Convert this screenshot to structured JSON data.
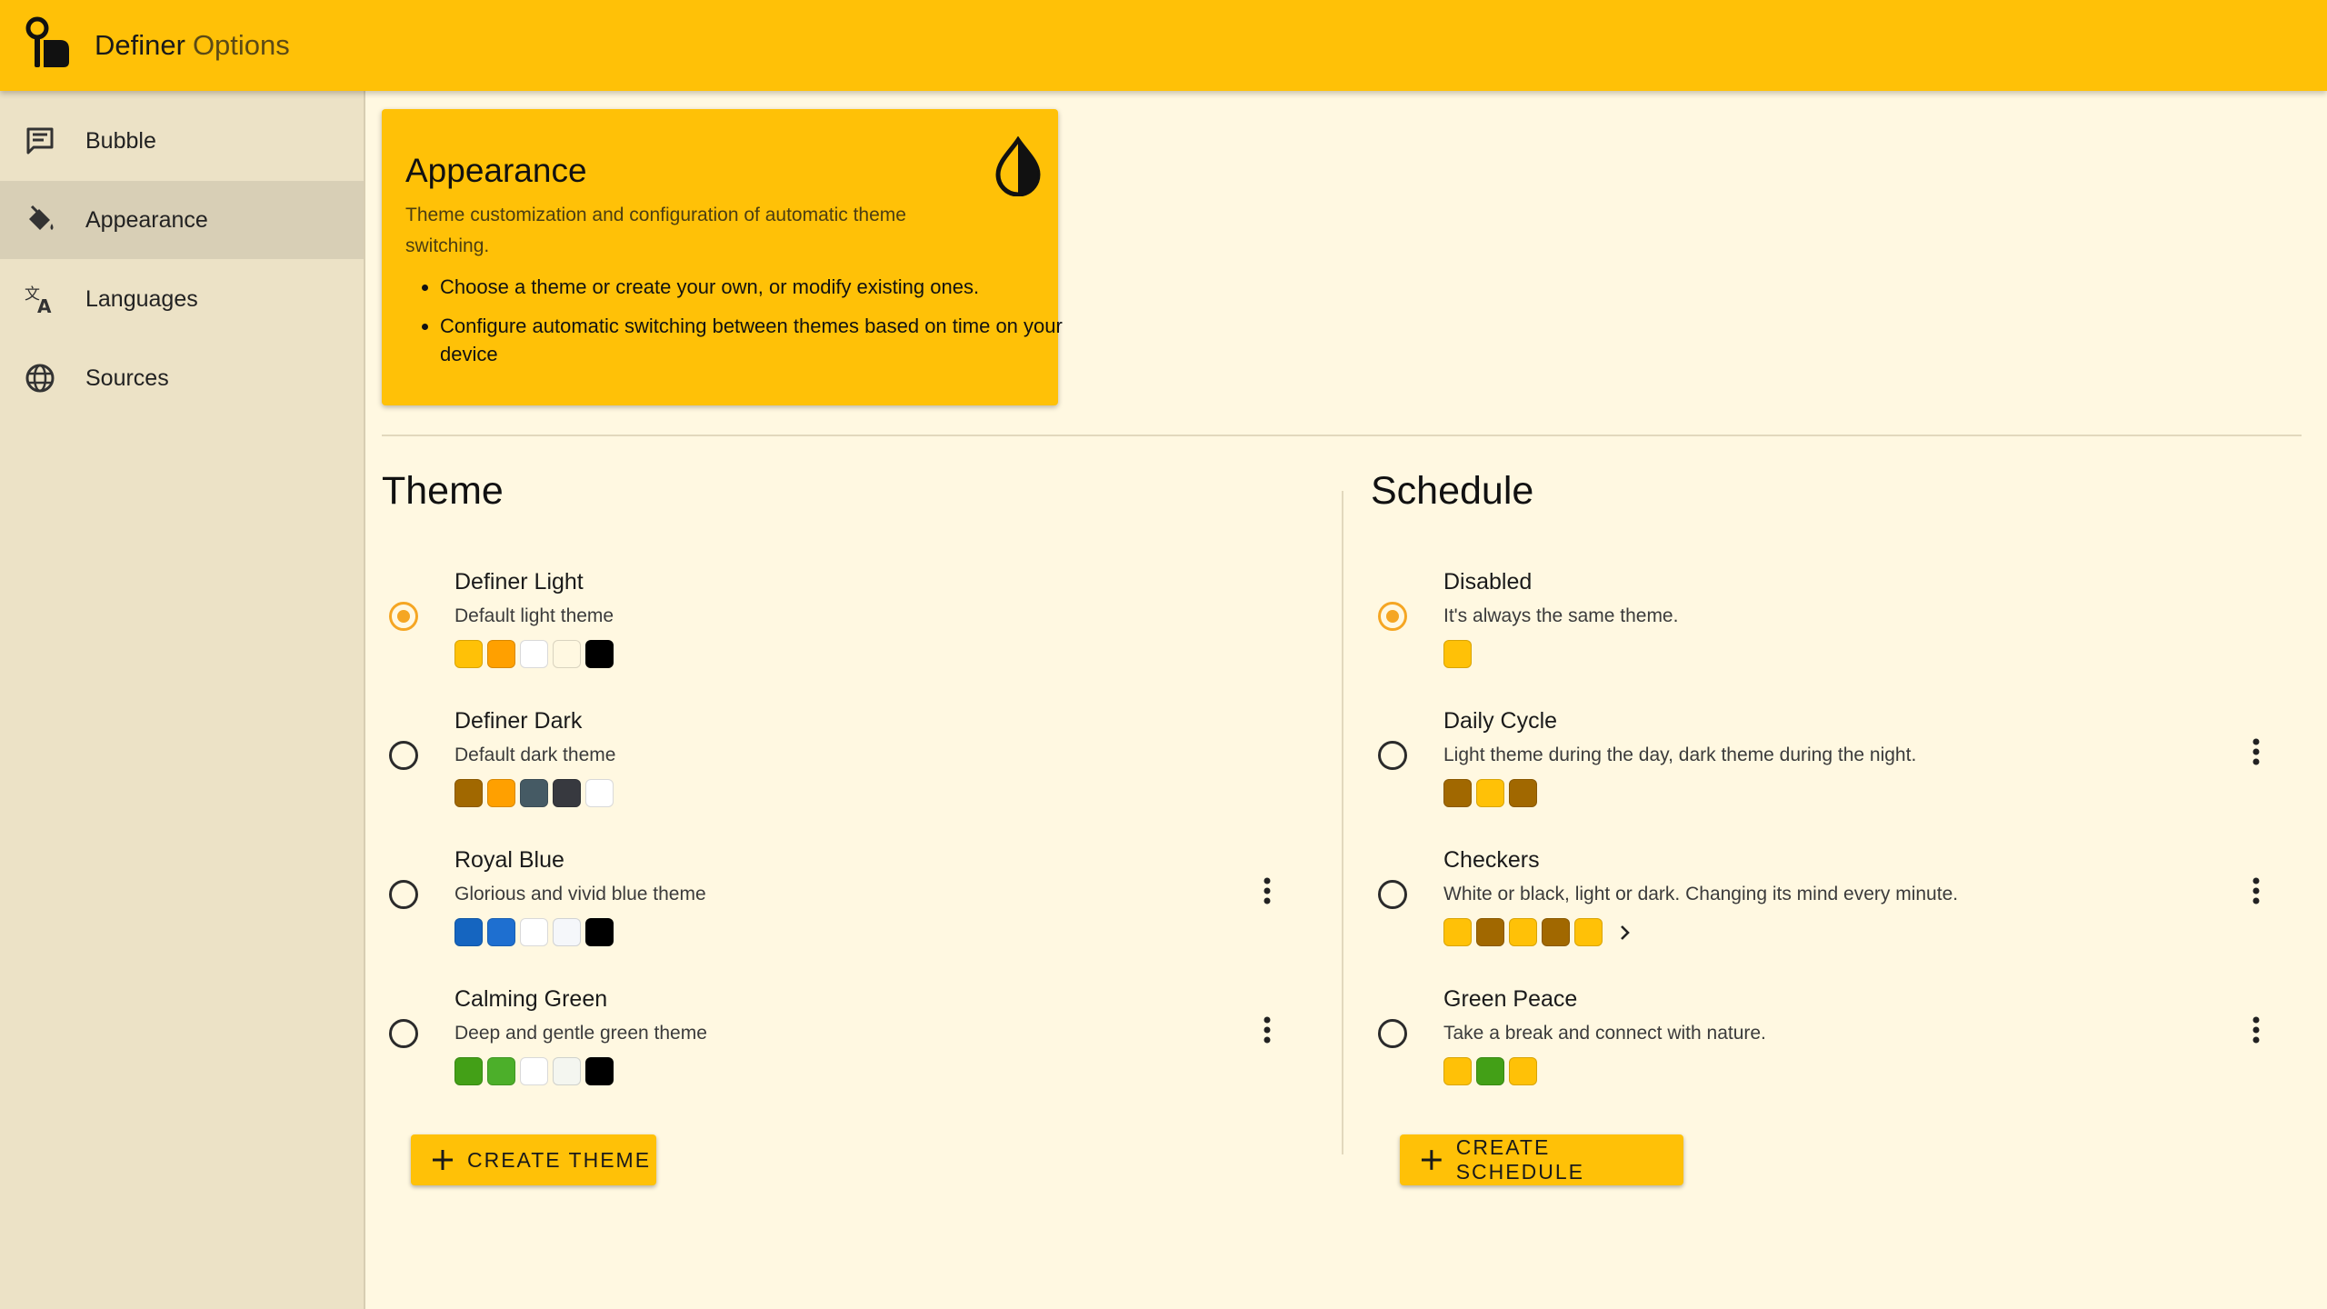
{
  "app": {
    "title": "Definer",
    "subtitle": "Options"
  },
  "sidebar": {
    "items": [
      {
        "label": "Bubble",
        "icon": "message-icon",
        "active": false
      },
      {
        "label": "Appearance",
        "icon": "paint-bucket-icon",
        "active": true
      },
      {
        "label": "Languages",
        "icon": "translate-icon",
        "active": false
      },
      {
        "label": "Sources",
        "icon": "globe-icon",
        "active": false
      }
    ]
  },
  "card": {
    "title": "Appearance",
    "description": "Theme customization and configuration of automatic theme switching.",
    "icon": "contrast-drop-icon",
    "bullets": [
      "Choose a theme or create your own, or modify existing ones.",
      "Configure automatic switching between themes based on time on your device"
    ]
  },
  "theme": {
    "title": "Theme",
    "items": [
      {
        "name": "Definer Light",
        "desc": "Default light theme",
        "selected": true,
        "has_menu": false,
        "colors": [
          "#ffc107",
          "#ffa000",
          "#ffffff",
          "#fff8e1",
          "#000000"
        ]
      },
      {
        "name": "Definer Dark",
        "desc": "Default dark theme",
        "selected": false,
        "has_menu": false,
        "colors": [
          "#a16800",
          "#ffa000",
          "#455a64",
          "#37393f",
          "#ffffff"
        ]
      },
      {
        "name": "Royal Blue",
        "desc": "Glorious and vivid blue theme",
        "selected": false,
        "has_menu": true,
        "colors": [
          "#1565c0",
          "#1e6fd0",
          "#ffffff",
          "#f5f7fa",
          "#000000"
        ]
      },
      {
        "name": "Calming Green",
        "desc": "Deep and gentle green theme",
        "selected": false,
        "has_menu": true,
        "colors": [
          "#43a017",
          "#4caf2a",
          "#ffffff",
          "#f4f6f0",
          "#000000"
        ]
      }
    ],
    "create_label": "CREATE THEME"
  },
  "schedule": {
    "title": "Schedule",
    "items": [
      {
        "name": "Disabled",
        "desc": "It's always the same theme.",
        "selected": true,
        "has_menu": false,
        "has_chevron": false,
        "colors": [
          "#ffc107"
        ]
      },
      {
        "name": "Daily Cycle",
        "desc": "Light theme during the day, dark theme during the night.",
        "selected": false,
        "has_menu": true,
        "has_chevron": false,
        "colors": [
          "#a16800",
          "#ffc107",
          "#a16800"
        ]
      },
      {
        "name": "Checkers",
        "desc": "White or black, light or dark. Changing its mind every minute.",
        "selected": false,
        "has_menu": true,
        "has_chevron": true,
        "colors": [
          "#ffc107",
          "#a16800",
          "#ffc107",
          "#a16800",
          "#ffc107"
        ]
      },
      {
        "name": "Green Peace",
        "desc": "Take a break and connect with nature.",
        "selected": false,
        "has_menu": true,
        "has_chevron": false,
        "colors": [
          "#ffc107",
          "#43a017",
          "#ffc107"
        ]
      }
    ],
    "create_label": "CREATE SCHEDULE"
  }
}
